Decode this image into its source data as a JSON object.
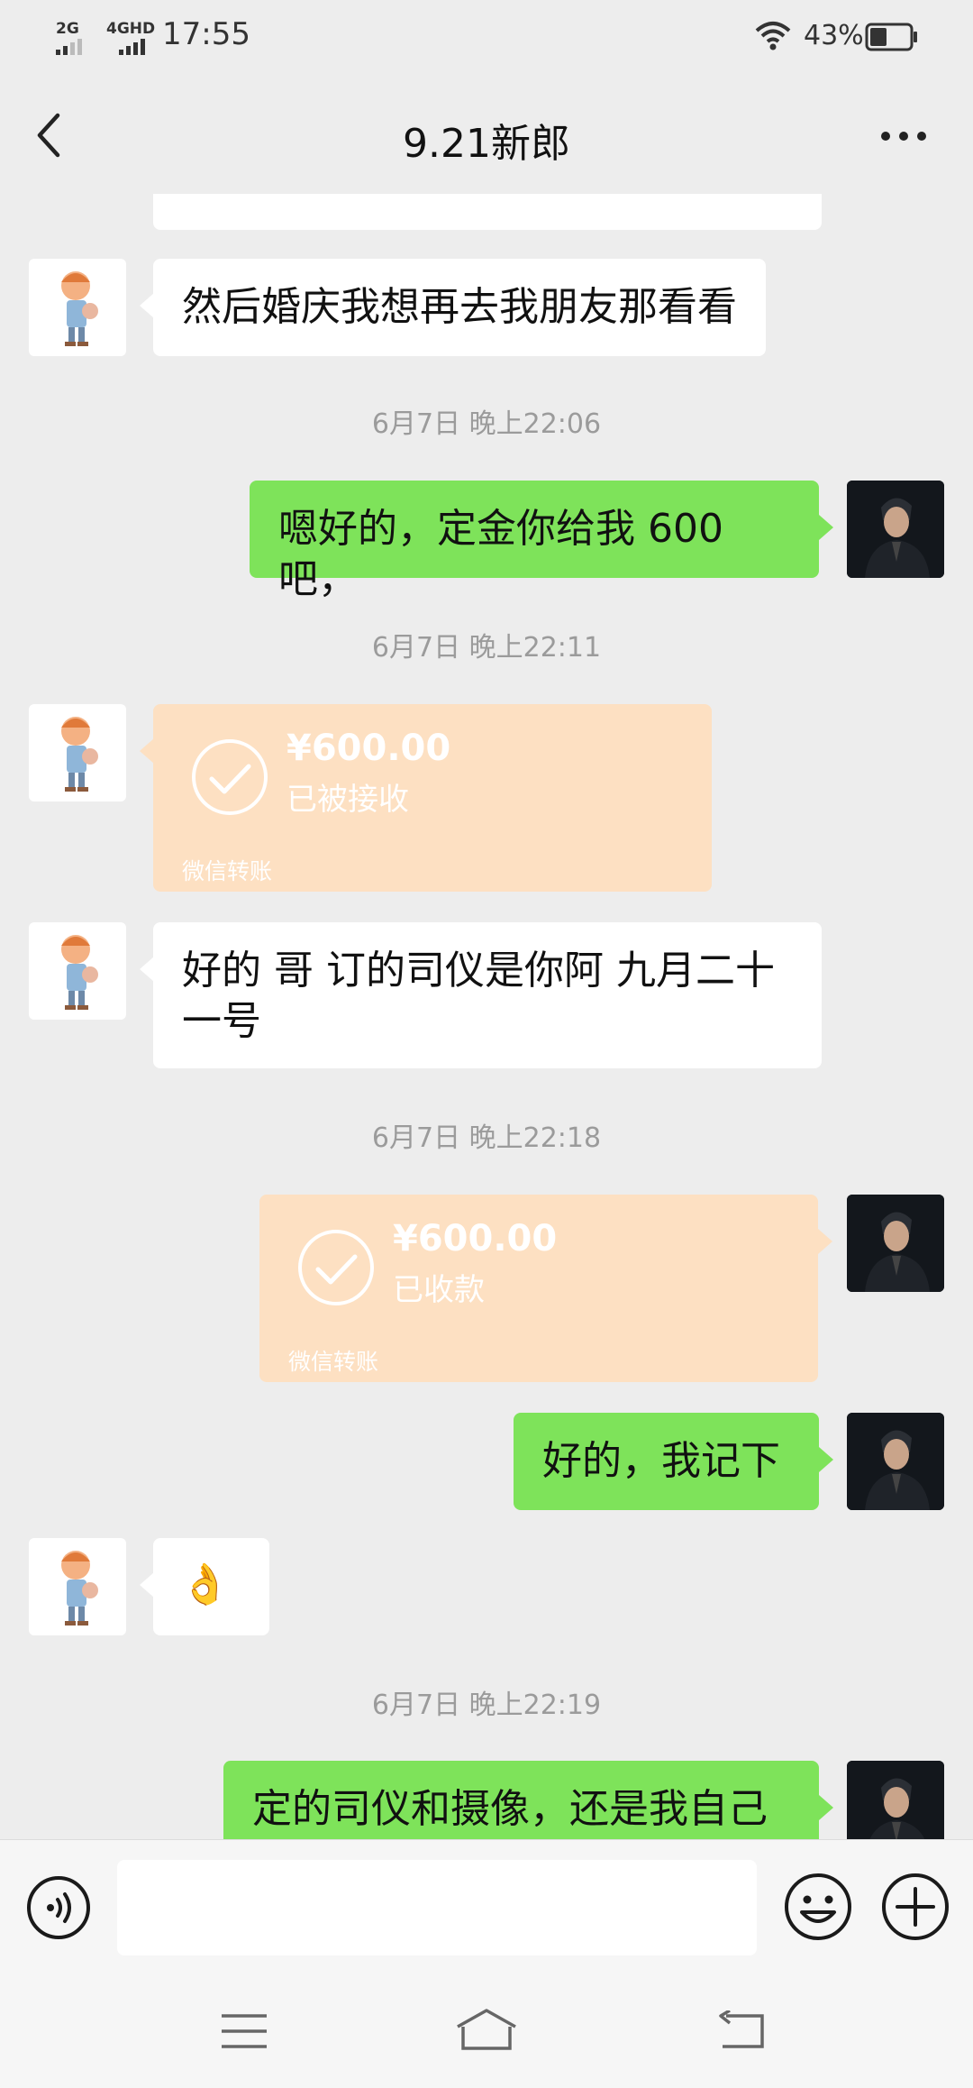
{
  "status_bar": {
    "signal1_label": "2G",
    "signal2_label": "4GHD",
    "time": "17:55",
    "battery_percent": "43%",
    "battery_level": 0.43
  },
  "nav": {
    "title": "9.21新郎",
    "back_icon": "chevron-left-icon",
    "more_icon": "more-dots-icon"
  },
  "messages": [
    {
      "side": "left",
      "type": "text",
      "text": "然后婚庆我想再去我朋友那看看"
    },
    {
      "type": "time",
      "text": "6月7日 晚上22:06"
    },
    {
      "side": "right",
      "type": "text",
      "text": "嗯好的，定金你给我 600 吧，"
    },
    {
      "type": "time",
      "text": "6月7日 晚上22:11"
    },
    {
      "side": "left",
      "type": "transfer",
      "amount": "¥600.00",
      "status": "已被接收",
      "footer": "微信转账"
    },
    {
      "side": "left",
      "type": "text",
      "text": "好的 哥 订的司仪是你阿 九月二十一号"
    },
    {
      "type": "time",
      "text": "6月7日 晚上22:18"
    },
    {
      "side": "right",
      "type": "transfer",
      "amount": "¥600.00",
      "status": "已收款",
      "footer": "微信转账"
    },
    {
      "side": "right",
      "type": "text",
      "text": "好的，我记下"
    },
    {
      "side": "left",
      "type": "emoji",
      "text": "👌"
    },
    {
      "type": "time",
      "text": "6月7日 晚上22:19"
    },
    {
      "side": "right",
      "type": "text",
      "text": "定的司仪和摄像，还是我自己"
    }
  ],
  "input_bar": {
    "voice_icon": "voice-icon",
    "input_value": "",
    "emoji_icon": "emoji-icon",
    "plus_icon": "plus-icon"
  },
  "system_nav": {
    "menu_icon": "menu-icon",
    "home_icon": "home-icon",
    "back_icon": "back-icon"
  },
  "colors": {
    "background": "#ededed",
    "bubble_self": "#7ee35a",
    "bubble_other": "#ffffff",
    "transfer": "#fde0c2",
    "timestamp": "#9b9b9b"
  }
}
